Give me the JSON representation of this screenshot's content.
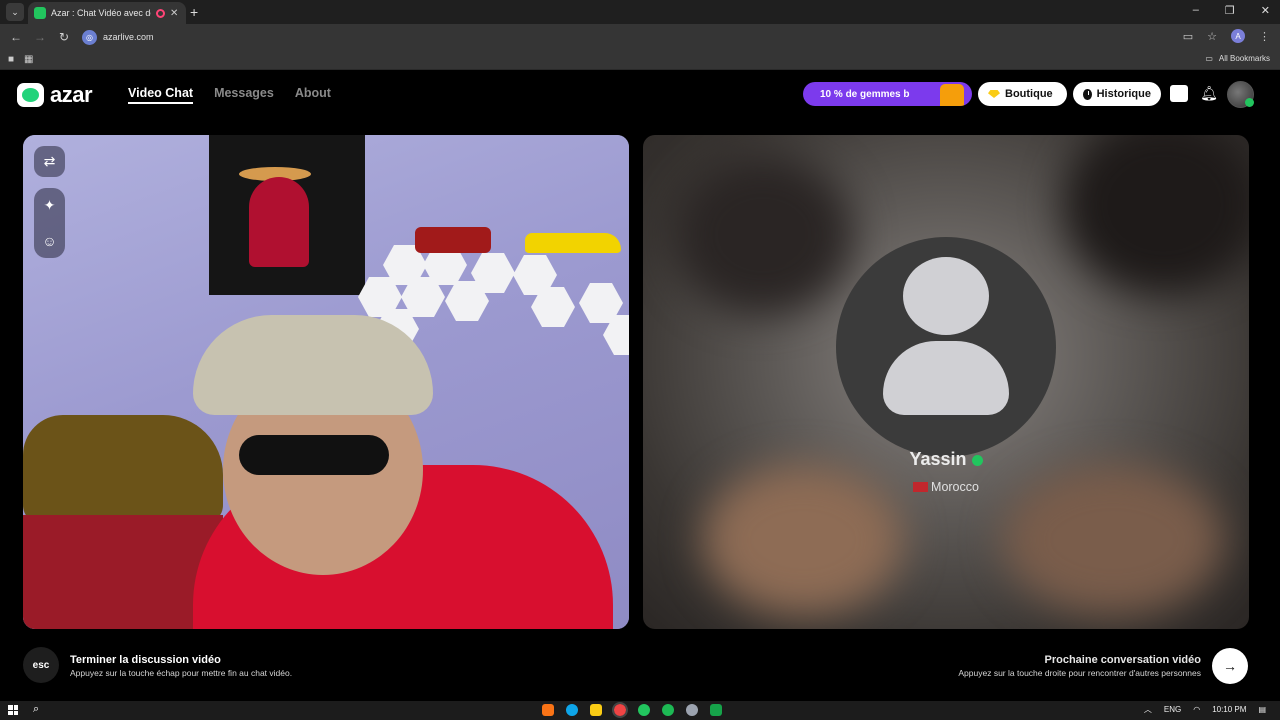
{
  "browser": {
    "tab_title": "Azar : Chat Vidéo avec de n",
    "url": "azarlive.com",
    "profile_initial": "A",
    "all_bookmarks": "All Bookmarks"
  },
  "header": {
    "logo_text": "azar",
    "nav": [
      {
        "label": "Video Chat",
        "active": true
      },
      {
        "label": "Messages",
        "active": false
      },
      {
        "label": "About",
        "active": false
      }
    ],
    "promo_label": "10 % de gemmes b",
    "boutique_label": "Boutique",
    "historique_label": "Historique"
  },
  "peer": {
    "name": "Yassin",
    "country": "Morocco"
  },
  "bottom": {
    "esc_label": "esc",
    "end_title": "Terminer la discussion vidéo",
    "end_sub": "Appuyez sur la touche échap pour mettre fin au chat vidéo.",
    "next_title": "Prochaine conversation vidéo",
    "next_sub": "Appuyez sur la touche droite pour rencontrer d'autres personnes"
  },
  "taskbar": {
    "lang": "ENG",
    "time": "10:10 PM"
  },
  "colors": {
    "accent_purple": "#7c3aed",
    "brand_green": "#22d37a",
    "hoodie_red": "#d80f2f"
  }
}
